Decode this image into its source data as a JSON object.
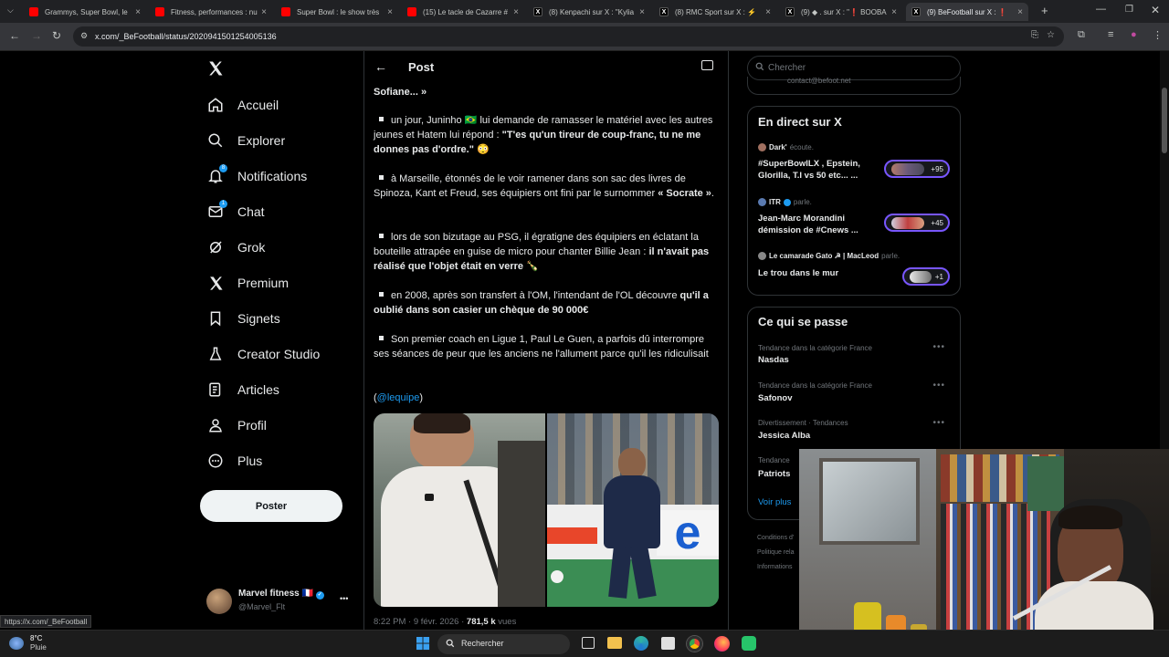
{
  "browser": {
    "tabs": [
      {
        "label": "Grammys, Super Bowl, le",
        "favicon": "youtube"
      },
      {
        "label": "Fitness, performances : nu",
        "favicon": "youtube"
      },
      {
        "label": "Super Bowl : le show très",
        "favicon": "youtube"
      },
      {
        "label": "(15) Le tacle de Cazarre #",
        "favicon": "youtube"
      },
      {
        "label": "(8) Kenpachi sur X : \"Kylia",
        "favicon": "x"
      },
      {
        "label": "(8) RMC Sport sur X : ⚡",
        "favicon": "x"
      },
      {
        "label": "(9) ◆ . sur X : \"❗ BOOBA",
        "favicon": "x"
      },
      {
        "label": "(9) BeFootball sur X : ❗",
        "favicon": "x"
      }
    ],
    "new_tab": "+",
    "url": "x.com/_BeFootball/status/2020941501254005136",
    "status_link": "https://x.com/_BeFootball"
  },
  "sidebar": {
    "items": [
      {
        "label": "Accueil",
        "icon": "home-icon"
      },
      {
        "label": "Explorer",
        "icon": "search-icon"
      },
      {
        "label": "Notifications",
        "icon": "bell-icon",
        "badge": "8"
      },
      {
        "label": "Chat",
        "icon": "mail-icon",
        "badge": "1"
      },
      {
        "label": "Grok",
        "icon": "grok-icon"
      },
      {
        "label": "Premium",
        "icon": "x-logo-icon"
      },
      {
        "label": "Signets",
        "icon": "bookmark-icon"
      },
      {
        "label": "Creator Studio",
        "icon": "flask-icon"
      },
      {
        "label": "Articles",
        "icon": "article-icon"
      },
      {
        "label": "Profil",
        "icon": "person-icon"
      },
      {
        "label": "Plus",
        "icon": "more-circle-icon"
      }
    ],
    "post_button": "Poster",
    "account": {
      "name": "Marvel fitness",
      "flag": "🇫🇷",
      "handle": "@Marvel_Flt",
      "more": "•••"
    }
  },
  "post": {
    "header_title": "Post",
    "top_cut": "Sofiane... »",
    "paragraphs": [
      {
        "normal": "un jour, Juninho 🇧🇷 lui demande de ramasser le matériel avec les autres jeunes et Hatem lui répond : ",
        "bold": "\"T'es qu'un tireur de coup-franc, tu ne me donnes pas d'ordre.\"",
        "tail": " 😳"
      },
      {
        "normal": "à Marseille, étonnés de le voir ramener dans son sac des livres de Spinoza, Kant et Freud, ses équipiers ont fini par le surnommer ",
        "bold": "« Socrate »",
        "tail": "."
      },
      {
        "normal": "lors de son bizutage au PSG, il égratigne des équipiers en éclatant la bouteille attrapée en guise de micro pour chanter Billie Jean : ",
        "bold": "il n'avait pas réalisé que l'objet était en verre",
        "tail": " 🍾"
      },
      {
        "normal": "en 2008, après son transfert à l'OM, l'intendant de l'OL découvre ",
        "bold": "qu'il a oublié dans son casier un chèque de 90 000€",
        "tail": ""
      },
      {
        "normal": "Son premier coach en Ligue 1, Paul Le Guen, a parfois dû interrompre ses séances de peur que les anciens ne l'allument parce qu'il les ridiculisait",
        "bold": "",
        "tail": ""
      }
    ],
    "source_open": "(",
    "source_mention": "@lequipe",
    "source_close": ")",
    "timestamp": "8:22 PM · 9 févr. 2026 · ",
    "views_count": "781,5 k",
    "views_label": " vues"
  },
  "right": {
    "search_placeholder": "Chercher",
    "top_cut": "contact@befoot.net",
    "live": {
      "title": "En direct sur X",
      "items": [
        {
          "host": "Dark'",
          "action": "écoute.",
          "title": "#SuperBowlLX , Epstein, Glorilla, T.I vs 50 etc... ...",
          "count": "+95"
        },
        {
          "host": "ITR",
          "action": "parle.",
          "title": "Jean-Marc Morandini démission de #Cnews ...",
          "count": "+45"
        },
        {
          "host": "Le camarade Gato ☭ | MacLeod",
          "action": "parle.",
          "title": "Le trou dans le mur",
          "count": "+1"
        }
      ]
    },
    "trends": {
      "title": "Ce qui se passe",
      "items": [
        {
          "category": "Tendance dans la catégorie France",
          "name": "Nasdas"
        },
        {
          "category": "Tendance dans la catégorie France",
          "name": "Safonov"
        },
        {
          "category": "Divertissement · Tendances",
          "name": "Jessica Alba"
        },
        {
          "category": "Tendance",
          "name": "Patriots"
        }
      ],
      "show_more": "Voir plus"
    },
    "footer": [
      "Conditions d'",
      "Politique rela",
      "Informations"
    ]
  },
  "taskbar": {
    "weather_temp": "8°C",
    "weather_desc": "Pluie",
    "search_label": "Rechercher"
  },
  "colors": {
    "accent": "#1d9bf0",
    "live_border": "#7856ff",
    "background": "#000000"
  }
}
